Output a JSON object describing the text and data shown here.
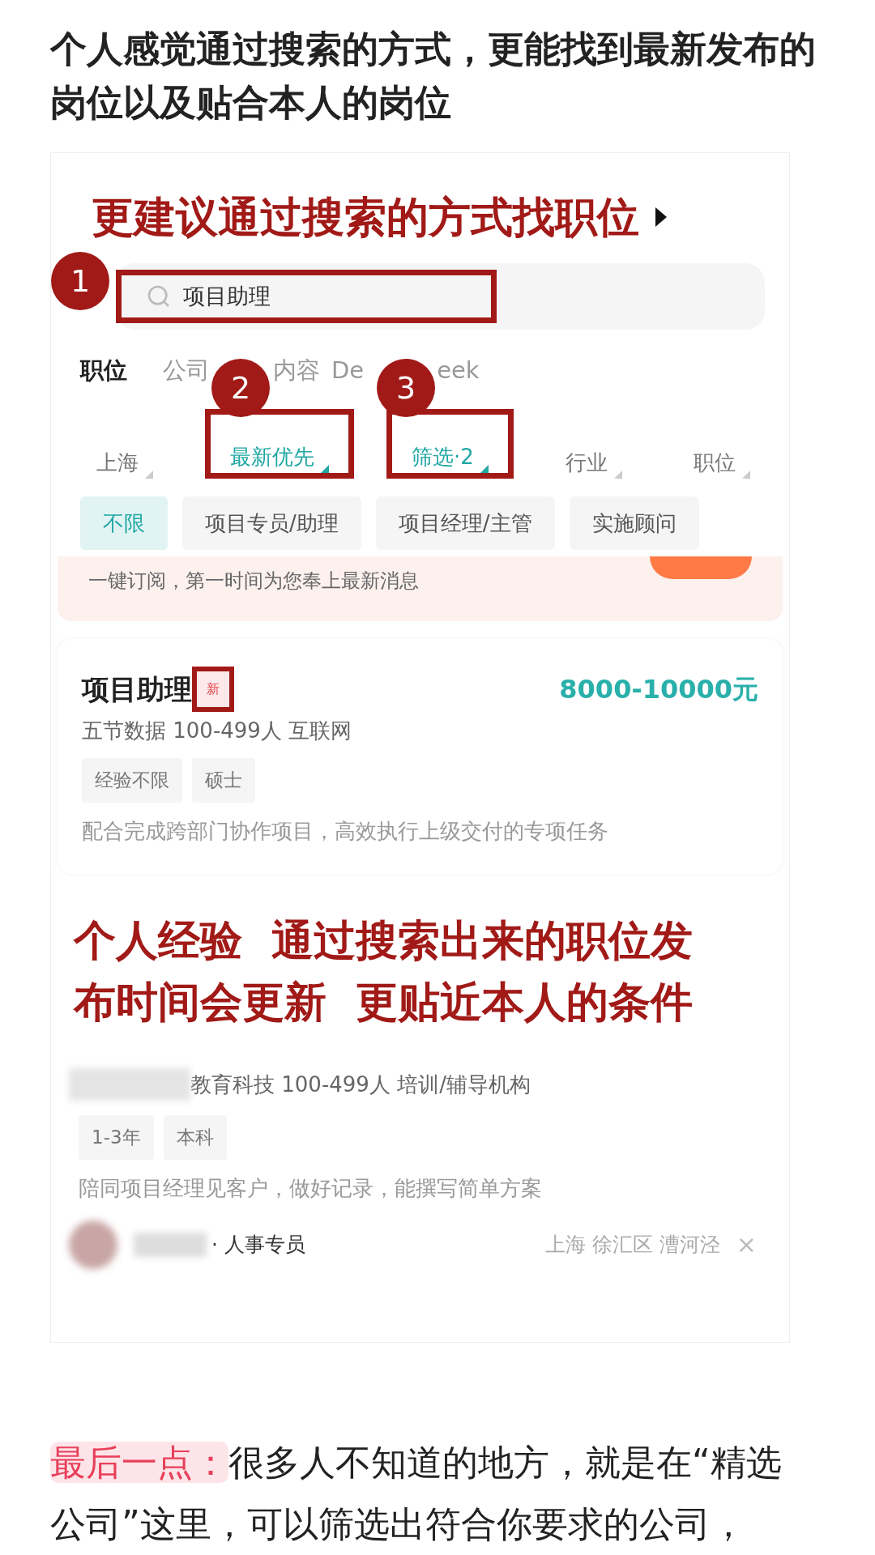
{
  "heading": "个人感觉通过搜索的方式，更能找到最新发布的岗位以及贴合本人的岗位",
  "screenshot": {
    "annotation_title": "更建议通过搜索的方式找职位",
    "search": {
      "value": "项目助理",
      "highlighted": true
    },
    "markers": [
      "1",
      "2",
      "3"
    ],
    "tabs": [
      {
        "label": "职位",
        "selected": true
      },
      {
        "label": "公司",
        "selected": false
      },
      {
        "label": "内容",
        "selected": false
      },
      {
        "label": "De",
        "label_after": "eek",
        "selected": false
      }
    ],
    "filters": [
      {
        "label": "上海",
        "active": false,
        "highlighted": false
      },
      {
        "label": "最新优先",
        "active": true,
        "highlighted": true
      },
      {
        "label": "筛选·2",
        "active": true,
        "highlighted": true
      },
      {
        "label": "行业",
        "active": false,
        "highlighted": false
      },
      {
        "label": "职位",
        "active": false,
        "highlighted": false
      }
    ],
    "chips": [
      {
        "label": "不限",
        "selected": true
      },
      {
        "label": "项目专员/助理",
        "selected": false
      },
      {
        "label": "项目经理/主管",
        "selected": false
      },
      {
        "label": "实施顾问",
        "selected": false
      }
    ],
    "subscribe_banner": {
      "text": "一键订阅，第一时间为您奉上最新消息"
    },
    "job": {
      "title": "项目助理",
      "badge": "新",
      "badge_highlighted": true,
      "salary": "8000-10000元",
      "company": "五节数据 100-499人 互联网",
      "tags": [
        "经验不限",
        "硕士"
      ],
      "description": "配合完成跨部门协作项目，高效执行上级交付的专项任务"
    },
    "annotation_note": [
      "个人经验  通过搜索出来的职位发",
      "布时间会更新  更贴近本人的条件"
    ],
    "job2": {
      "company": "教育科技 100-499人 培训/辅导机构",
      "tags": [
        "1-3年",
        "本科"
      ],
      "description": "陪同项目经理见客户，做好记录，能撰写简单方案",
      "recruiter": "· 人事专员",
      "location": "上海 徐汇区 漕河泾",
      "close": "×"
    }
  },
  "paragraph": {
    "highlight": "最后一点：",
    "text": "很多人不知道的地方，就是在“精选公司”这里，可以筛选出符合你要求的公司，"
  }
}
